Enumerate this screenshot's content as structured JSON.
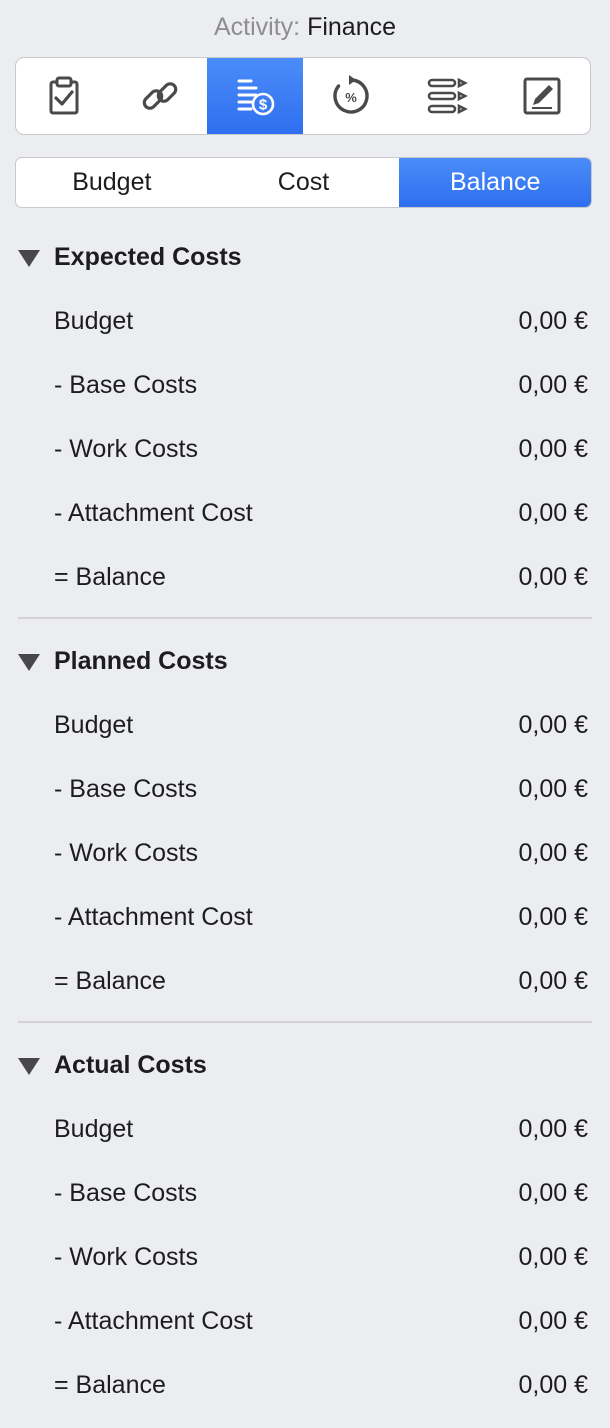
{
  "header": {
    "prefix": "Activity:",
    "value": "Finance"
  },
  "toolbar": {
    "items": [
      {
        "icon": "clipboard-check-icon",
        "active": false
      },
      {
        "icon": "link-icon",
        "active": false
      },
      {
        "icon": "finance-list-dollar-icon",
        "active": true
      },
      {
        "icon": "percent-progress-icon",
        "active": false
      },
      {
        "icon": "outline-list-icon",
        "active": false
      },
      {
        "icon": "edit-note-icon",
        "active": false
      }
    ],
    "accent_color": "#3b82f6"
  },
  "tabs": [
    {
      "label": "Budget",
      "active": false
    },
    {
      "label": "Cost",
      "active": false
    },
    {
      "label": "Balance",
      "active": true
    }
  ],
  "sections": [
    {
      "title": "Expected Costs",
      "rows": [
        {
          "label": "Budget",
          "value": "0,00 €"
        },
        {
          "label": "- Base Costs",
          "value": "0,00 €"
        },
        {
          "label": "- Work Costs",
          "value": "0,00 €"
        },
        {
          "label": "- Attachment Cost",
          "value": "0,00 €"
        },
        {
          "label": "= Balance",
          "value": "0,00 €"
        }
      ]
    },
    {
      "title": "Planned Costs",
      "rows": [
        {
          "label": "Budget",
          "value": "0,00 €"
        },
        {
          "label": "- Base Costs",
          "value": "0,00 €"
        },
        {
          "label": "- Work Costs",
          "value": "0,00 €"
        },
        {
          "label": "- Attachment Cost",
          "value": "0,00 €"
        },
        {
          "label": "= Balance",
          "value": "0,00 €"
        }
      ]
    },
    {
      "title": "Actual Costs",
      "rows": [
        {
          "label": "Budget",
          "value": "0,00 €"
        },
        {
          "label": "- Base Costs",
          "value": "0,00 €"
        },
        {
          "label": "- Work Costs",
          "value": "0,00 €"
        },
        {
          "label": "- Attachment Cost",
          "value": "0,00 €"
        },
        {
          "label": "= Balance",
          "value": "0,00 €"
        }
      ]
    }
  ]
}
